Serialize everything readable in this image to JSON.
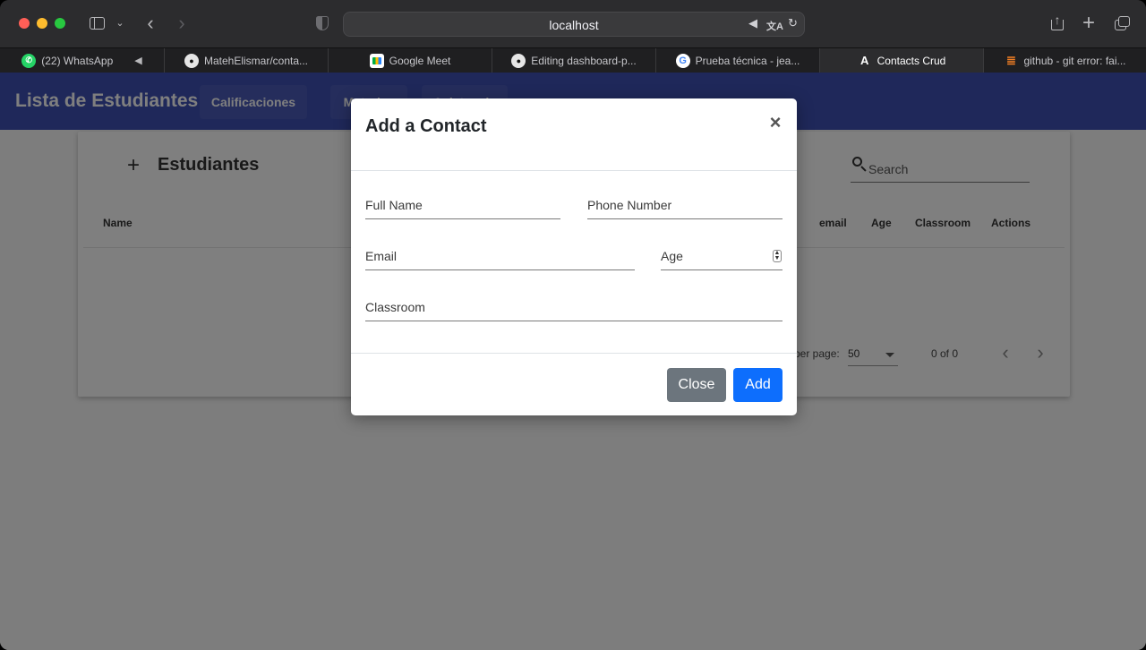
{
  "browser": {
    "url": "localhost",
    "tabs": [
      {
        "label": "(22) WhatsApp",
        "icon": "whatsapp-icon",
        "active": false
      },
      {
        "label": "MatehElismar/conta...",
        "icon": "github-icon",
        "active": false
      },
      {
        "label": "Google Meet",
        "icon": "google-meet-icon",
        "active": false
      },
      {
        "label": "Editing dashboard-p...",
        "icon": "github-icon",
        "active": false
      },
      {
        "label": "Prueba técnica - jea...",
        "icon": "google-icon",
        "active": false
      },
      {
        "label": "Contacts Crud",
        "icon": "angular-icon",
        "active": true
      },
      {
        "label": "github - git error: fai...",
        "icon": "stackoverflow-icon",
        "active": false
      }
    ]
  },
  "app": {
    "title": "Lista de Estudiantes",
    "nav": [
      "Calificaciones",
      "Materias",
      "Asistencia"
    ],
    "colors": {
      "appbar": "#3f51b5"
    }
  },
  "card": {
    "add_glyph": "+",
    "title": "Estudiantes",
    "search_placeholder": "Search",
    "columns": [
      "Name",
      "email",
      "Age",
      "Classroom",
      "Actions"
    ],
    "rows_per_page_label": "per page:",
    "rows_per_page_value": "50",
    "range": "0 of 0"
  },
  "modal": {
    "title": "Add a Contact",
    "close_glyph": "×",
    "fields": {
      "full_name": "Full Name",
      "phone": "Phone Number",
      "email": "Email",
      "age": "Age",
      "classroom": "Classroom"
    },
    "buttons": {
      "close": "Close",
      "add": "Add"
    },
    "colors": {
      "close": "#6c757d",
      "add": "#0d6efd"
    }
  }
}
